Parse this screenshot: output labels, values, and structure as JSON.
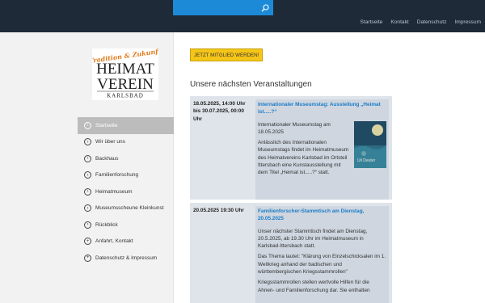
{
  "search": {
    "placeholder": ""
  },
  "topnav": [
    {
      "label": "Startseite"
    },
    {
      "label": "Kontakt"
    },
    {
      "label": "Datenschutz"
    },
    {
      "label": "Impressum"
    }
  ],
  "logo": {
    "tagline": "Tradition & Zukunft",
    "line1": "HEIMAT",
    "line2": "VEREIN",
    "line3": "KARLSBAD"
  },
  "sidebar": {
    "items": [
      {
        "label": "Startseite",
        "icon": "circle-arrow-right-icon",
        "active": true
      },
      {
        "label": "Wir über uns",
        "icon": "circle-arrow-right-icon"
      },
      {
        "label": "Backhaus",
        "icon": "circle-arrow-right-icon"
      },
      {
        "label": "Familienforschung",
        "icon": "circle-arrow-right-icon"
      },
      {
        "label": "Heimatmuseum",
        "icon": "circle-arrow-right-icon"
      },
      {
        "label": "Museumsscheune Kleinkunst",
        "icon": "circle-arrow-right-icon"
      },
      {
        "label": "Rückblick",
        "icon": "circle-arrow-right-icon"
      },
      {
        "label": "Anfahrt, Kontakt",
        "icon": "circle-plus-icon"
      },
      {
        "label": "Datenschutz & Impressum",
        "icon": "circle-plus-icon"
      }
    ]
  },
  "main": {
    "member_button": "JETZT MITGLIED WERDEN!",
    "section_title": "Unsere nächsten Veranstaltungen",
    "events": [
      {
        "date": "18.05.2025, 14:00 Uhr bis 30.07.2025, 00:00 Uhr",
        "title": "Internationaler Museumstag: Ausstellung „Heimat ist.....?“",
        "p1": "Internationaler Museumstag am 18.05.2025",
        "p2": "Anlässlich des Internationalen Museumstags findet im Heimatmuseum des Heimatvereins Karlsbad im Ortsteil Ittersbach eine Kunstausstellung mit dem Titel „Heimat ist.....?“ statt.",
        "image_caption": "Uli Deuter"
      },
      {
        "date": "20.05.2025 19:30 Uhr",
        "title": "Familienforscher-Stammtisch am Dienstag, 20.05.2025",
        "p1": "Unser nächster Stammtisch findet am Dienstag, 20.5.2025, ab 19.30 Uhr im Heimatmuseum in Karlsbad-Ittersbach statt.",
        "p2": "Das Thema lautet: \"Klärung von Einzelschicksalen im 1. Weltkrieg anhand der badischen und württembergischen Kriegsstammrollen\"",
        "p3": "Kriegsstammrollen stellen wertvolle Hilfen für die Ahnen- und Familienforschung dar. Sie enthalten"
      }
    ]
  },
  "colors": {
    "topbar": "#1e2a38",
    "search": "#1d8ad8",
    "member_button": "#f5c518",
    "link": "#1a7cc9",
    "event_bg": "#dfe4ea"
  }
}
